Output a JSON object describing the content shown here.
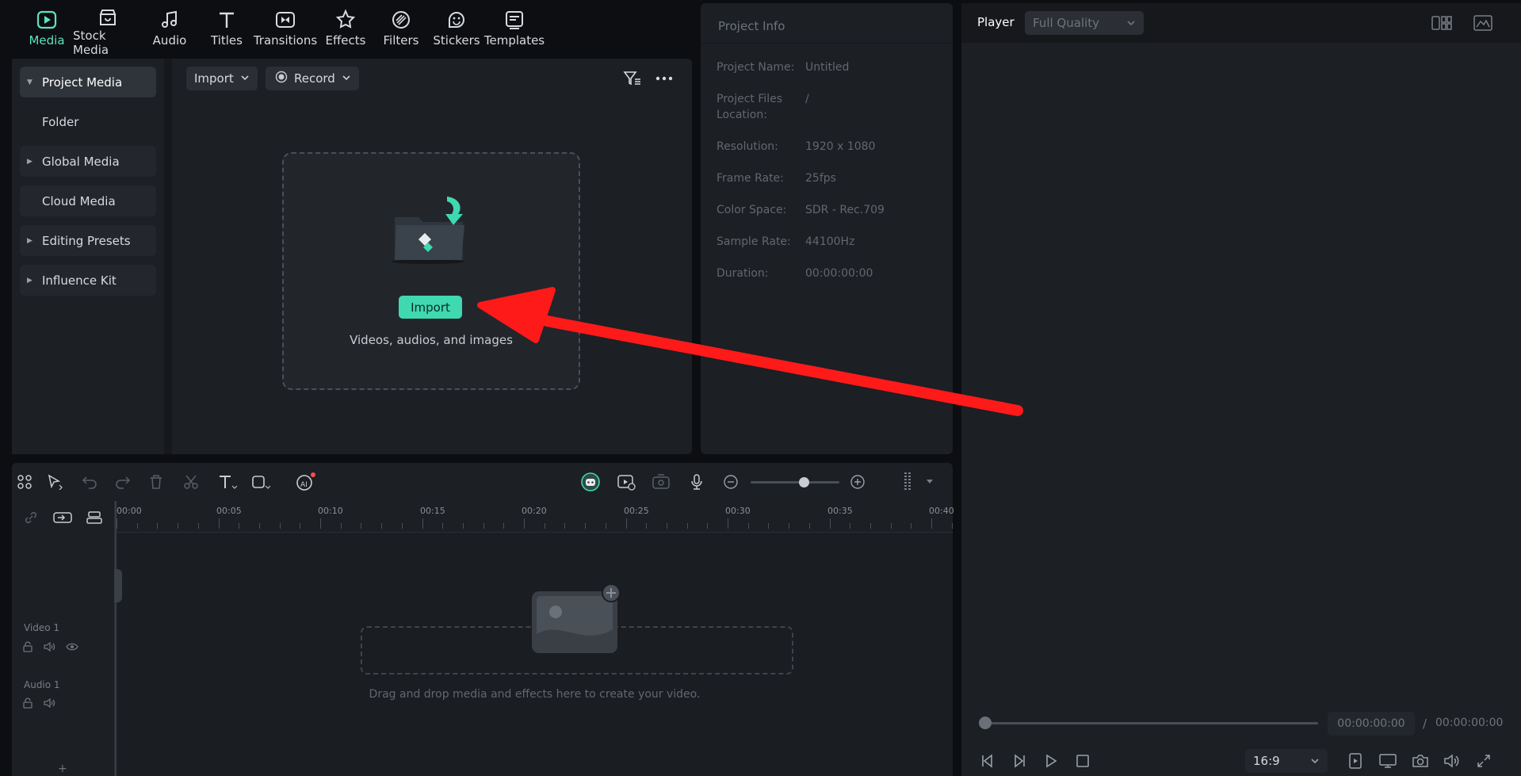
{
  "toolbar": {
    "tabs": [
      {
        "label": "Media",
        "icon": "media-icon"
      },
      {
        "label": "Stock Media",
        "icon": "stock-media-icon"
      },
      {
        "label": "Audio",
        "icon": "music-note-icon"
      },
      {
        "label": "Titles",
        "icon": "text-t-icon"
      },
      {
        "label": "Transitions",
        "icon": "transitions-icon"
      },
      {
        "label": "Effects",
        "icon": "effects-icon"
      },
      {
        "label": "Filters",
        "icon": "filters-icon"
      },
      {
        "label": "Stickers",
        "icon": "stickers-icon"
      },
      {
        "label": "Templates",
        "icon": "templates-icon"
      }
    ],
    "active_tab": "Media"
  },
  "media_sidebar": {
    "items": [
      {
        "label": "Project Media",
        "expandable": true,
        "active": true
      },
      {
        "label": "Folder",
        "expandable": false,
        "active": false
      },
      {
        "label": "Global Media",
        "expandable": true,
        "active": false
      },
      {
        "label": "Cloud Media",
        "expandable": false,
        "active": false
      },
      {
        "label": "Editing Presets",
        "expandable": true,
        "active": false
      },
      {
        "label": "Influence Kit",
        "expandable": true,
        "active": false
      }
    ]
  },
  "media_toolbar": {
    "import_label": "Import",
    "record_label": "Record"
  },
  "dropzone": {
    "import_button": "Import",
    "hint": "Videos, audios, and images"
  },
  "project_info": {
    "title": "Project Info",
    "rows": [
      {
        "key": "Project Name:",
        "value": "Untitled"
      },
      {
        "key": "Project Files Location:",
        "value": "/"
      },
      {
        "key": "Resolution:",
        "value": "1920 x 1080"
      },
      {
        "key": "Frame Rate:",
        "value": "25fps"
      },
      {
        "key": "Color Space:",
        "value": "SDR - Rec.709"
      },
      {
        "key": "Sample Rate:",
        "value": "44100Hz"
      },
      {
        "key": "Duration:",
        "value": "00:00:00:00"
      }
    ]
  },
  "player": {
    "label": "Player",
    "quality": "Full Quality",
    "current_time": "00:00:00:00",
    "separator": "/",
    "total_time": "00:00:00:00",
    "aspect_ratio": "16:9"
  },
  "timeline": {
    "ruler_labels": [
      "00:00",
      "00:05",
      "00:10",
      "00:15",
      "00:20",
      "00:25",
      "00:30",
      "00:35",
      "00:40"
    ],
    "tracks": [
      {
        "label": "Video 1"
      },
      {
        "label": "Audio 1"
      }
    ],
    "hint": "Drag and drop media and effects here to create your video.",
    "add_track": "+"
  },
  "colors": {
    "accent": "#3fd8b0",
    "annotation_arrow": "#ff1a1a"
  }
}
